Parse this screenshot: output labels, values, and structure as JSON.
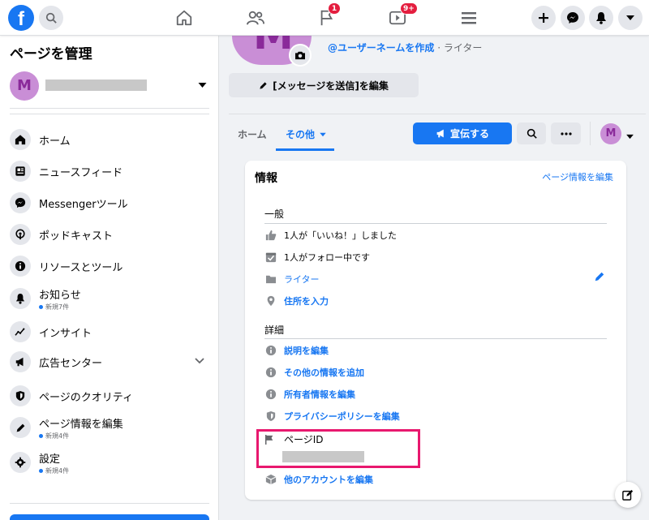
{
  "topbar": {
    "logo_letter": "f",
    "notifications_badge": "1",
    "watch_badge": "9+"
  },
  "sidebar": {
    "title": "ページを管理",
    "page_avatar_letter": "M",
    "items": [
      {
        "label": "ホーム",
        "icon": "home-icon"
      },
      {
        "label": "ニュースフィード",
        "icon": "newsfeed-icon"
      },
      {
        "label": "Messengerツール",
        "icon": "messenger-icon"
      },
      {
        "label": "ポッドキャスト",
        "icon": "podcast-icon"
      },
      {
        "label": "リソースとツール",
        "icon": "info-icon"
      },
      {
        "label": "お知らせ",
        "icon": "bell-icon",
        "sub": "新規7件"
      },
      {
        "label": "インサイト",
        "icon": "insights-icon"
      },
      {
        "label": "広告センター",
        "icon": "megaphone-icon"
      },
      {
        "label": "ページのクオリティ",
        "icon": "shield-icon"
      },
      {
        "label": "ページ情報を編集",
        "icon": "pencil-icon",
        "sub": "新規4件"
      },
      {
        "label": "設定",
        "icon": "gear-icon",
        "sub": "新規4件"
      }
    ]
  },
  "main": {
    "avatar_letter": "M",
    "username_link": "@ユーザーネームを作成",
    "username_sep": " · ",
    "role": "ライター",
    "message_button": "[メッセージを送信]を編集",
    "tabs": {
      "home": "ホーム",
      "more": "その他"
    },
    "promote_button": "宣伝する",
    "avatar_small_letter": "M"
  },
  "info_card": {
    "title": "情報",
    "edit_link": "ページ情報を編集",
    "general": {
      "heading": "一般",
      "rows": [
        {
          "text": "1人が「いいね！」しました",
          "icon": "thumbs-up-icon"
        },
        {
          "text": "1人がフォロー中です",
          "icon": "follow-check-icon"
        },
        {
          "text": "ライター",
          "icon": "folder-icon"
        },
        {
          "text": "住所を入力",
          "icon": "location-pin-icon"
        }
      ]
    },
    "details": {
      "heading": "詳細",
      "rows": [
        {
          "text": "説明を編集",
          "icon": "info-icon"
        },
        {
          "text": "その他の情報を追加",
          "icon": "info-icon"
        },
        {
          "text": "所有者情報を編集",
          "icon": "info-icon"
        },
        {
          "text": "プライバシーポリシーを編集",
          "icon": "shield-icon"
        }
      ]
    },
    "page_id_label": "ページID",
    "other_accounts": "他のアカウントを編集"
  },
  "colors": {
    "accent": "#1877f2",
    "highlight": "#e8186e",
    "badge": "#e41e3f"
  }
}
